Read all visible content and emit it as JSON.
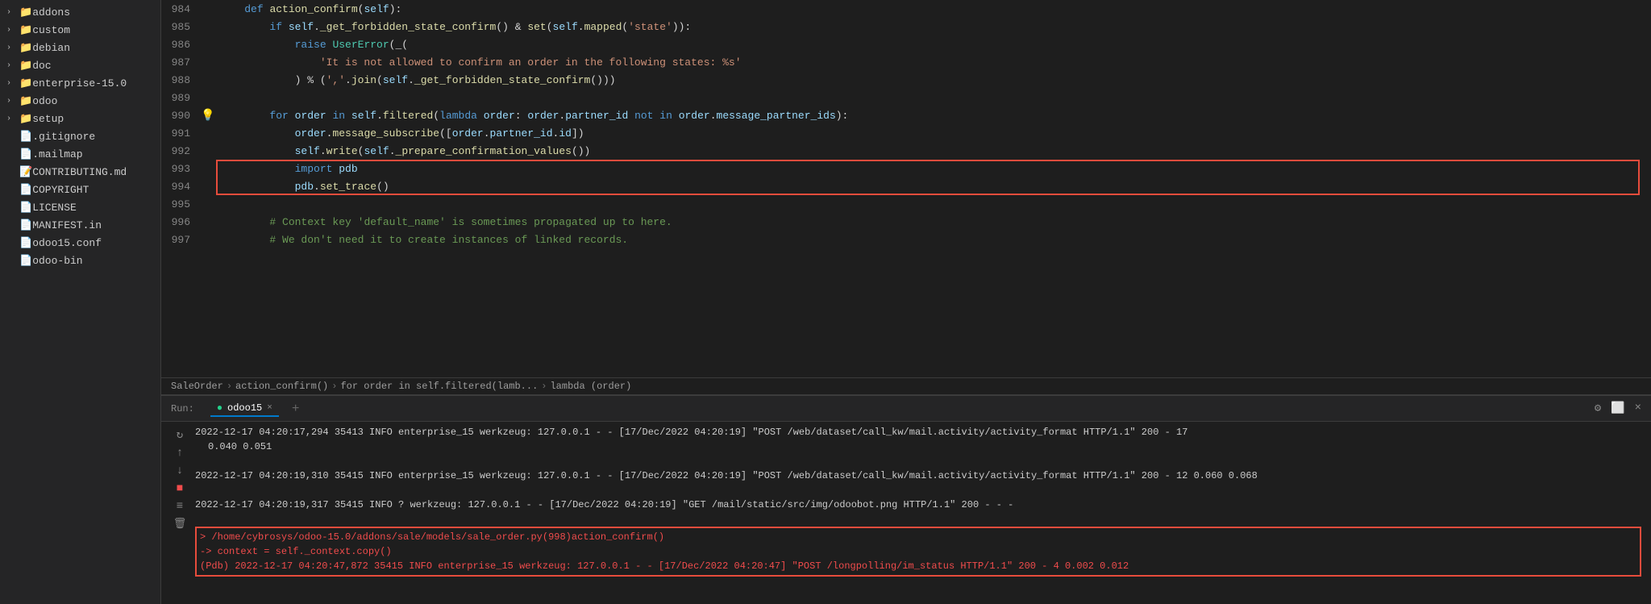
{
  "sidebar": {
    "items": [
      {
        "label": "addons",
        "type": "folder",
        "indent": 0,
        "expanded": false
      },
      {
        "label": "custom",
        "type": "folder",
        "indent": 0,
        "expanded": false
      },
      {
        "label": "debian",
        "type": "folder",
        "indent": 0,
        "expanded": false
      },
      {
        "label": "doc",
        "type": "folder",
        "indent": 0,
        "expanded": false
      },
      {
        "label": "enterprise-15.0",
        "type": "folder",
        "indent": 0,
        "expanded": false
      },
      {
        "label": "odoo",
        "type": "folder",
        "indent": 0,
        "expanded": false
      },
      {
        "label": "setup",
        "type": "folder",
        "indent": 0,
        "expanded": false
      },
      {
        "label": ".gitignore",
        "type": "file",
        "indent": 0
      },
      {
        "label": ".mailmap",
        "type": "file",
        "indent": 0
      },
      {
        "label": "CONTRIBUTING.md",
        "type": "file-md",
        "indent": 0
      },
      {
        "label": "COPYRIGHT",
        "type": "file",
        "indent": 0
      },
      {
        "label": "LICENSE",
        "type": "file",
        "indent": 0
      },
      {
        "label": "MANIFEST.in",
        "type": "file",
        "indent": 0
      },
      {
        "label": "odoo15.conf",
        "type": "file-conf",
        "indent": 0
      },
      {
        "label": "odoo-bin",
        "type": "file",
        "indent": 0
      }
    ]
  },
  "editor": {
    "lines": [
      {
        "num": "984",
        "content": "    def action_confirm(self):"
      },
      {
        "num": "985",
        "content": "        if self._get_forbidden_state_confirm() & set(self.mapped('state')):"
      },
      {
        "num": "986",
        "content": "            raise UserError(_("
      },
      {
        "num": "987",
        "content": "                'It is not allowed to confirm an order in the following states: %s'"
      },
      {
        "num": "988",
        "content": "            ) % (','.join(self._get_forbidden_state_confirm()))"
      },
      {
        "num": "989",
        "content": ""
      },
      {
        "num": "990",
        "content": "        for order in self.filtered(lambda order: order.partner_id not in order.message_partner_ids):"
      },
      {
        "num": "991",
        "content": "            order.message_subscribe([order.partner_id.id])"
      },
      {
        "num": "992",
        "content": "            self.write(self._prepare_confirmation_values())"
      },
      {
        "num": "993",
        "content": "            import pdb"
      },
      {
        "num": "994",
        "content": "            pdb.set_trace()"
      },
      {
        "num": "995",
        "content": ""
      },
      {
        "num": "996",
        "content": "        # Context key 'default_name' is sometimes propagated up to here."
      },
      {
        "num": "997",
        "content": "        # We don't need it to create instances of linked records."
      }
    ]
  },
  "breadcrumb": {
    "parts": [
      "SaleOrder",
      "action_confirm()",
      "for order in self.filtered(lamb...",
      "lambda (order)"
    ]
  },
  "terminal": {
    "run_label": "Run:",
    "tab_label": "odoo15",
    "logs": [
      {
        "text": "2022-12-17 04:20:17,294 35413 INFO enterprise_15 werkzeug: 127.0.0.1 - - [17/Dec/2022 04:20:19] \"POST /web/dataset/call_kw/mail.activity/activity_format HTTP/1.1\" 200 - 17 0.040 0.051",
        "type": "normal"
      },
      {
        "text": "2022-12-17 04:20:19,310 35415 INFO enterprise_15 werkzeug: 127.0.0.1 - - [17/Dec/2022 04:20:19] \"POST /web/dataset/call_kw/mail.activity/activity_format HTTP/1.1\" 200 - 12 0.060 0.068",
        "type": "normal"
      },
      {
        "text": "2022-12-17 04:20:19,317 35415 INFO ? werkzeug: 127.0.0.1 - - [17/Dec/2022 04:20:19] \"GET /mail/static/src/img/odoobot.png HTTP/1.1\" 200 - - -",
        "type": "normal"
      },
      {
        "text": "> /home/cybrosys/odoo-15.0/addons/sale/models/sale_order.py(998)action_confirm()",
        "type": "red",
        "debug": true
      },
      {
        "text": "-> context = self._context.copy()",
        "type": "red",
        "debug": true
      },
      {
        "text": "(Pdb) 2022-12-17 04:20:47,872 35415 INFO enterprise_15 werkzeug: 127.0.0.1 - - [17/Dec/2022 04:20:47] \"POST /longpolling/im_status HTTP/1.1\" 200 - 4 0.002 0.012",
        "type": "red",
        "debug": true
      }
    ]
  },
  "icons": {
    "bulb": "💡",
    "gear": "⚙",
    "arrow_right": "›",
    "close": "×",
    "run_circle": "●",
    "up_arrow": "↑",
    "down_arrow": "↓",
    "stop": "■",
    "lines": "≡",
    "trash": "🗑"
  }
}
